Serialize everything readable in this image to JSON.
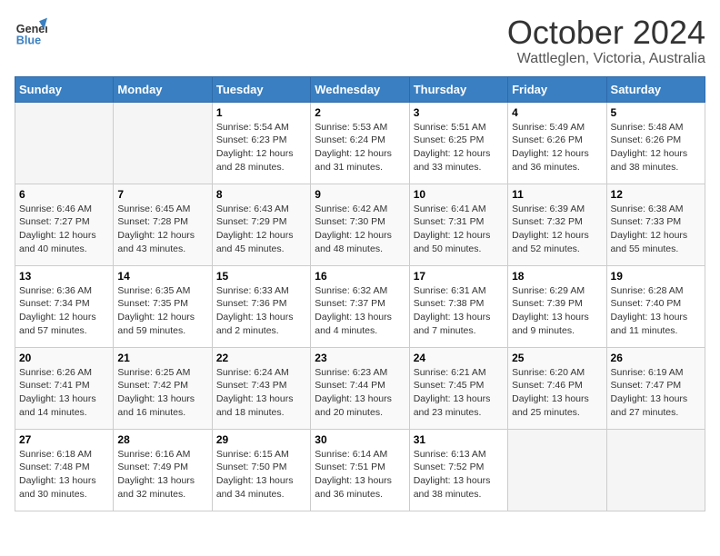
{
  "header": {
    "logo_line1": "General",
    "logo_line2": "Blue",
    "month": "October 2024",
    "location": "Wattleglen, Victoria, Australia"
  },
  "days_of_week": [
    "Sunday",
    "Monday",
    "Tuesday",
    "Wednesday",
    "Thursday",
    "Friday",
    "Saturday"
  ],
  "weeks": [
    [
      {
        "day": "",
        "info": ""
      },
      {
        "day": "",
        "info": ""
      },
      {
        "day": "1",
        "info": "Sunrise: 5:54 AM\nSunset: 6:23 PM\nDaylight: 12 hours and 28 minutes."
      },
      {
        "day": "2",
        "info": "Sunrise: 5:53 AM\nSunset: 6:24 PM\nDaylight: 12 hours and 31 minutes."
      },
      {
        "day": "3",
        "info": "Sunrise: 5:51 AM\nSunset: 6:25 PM\nDaylight: 12 hours and 33 minutes."
      },
      {
        "day": "4",
        "info": "Sunrise: 5:49 AM\nSunset: 6:26 PM\nDaylight: 12 hours and 36 minutes."
      },
      {
        "day": "5",
        "info": "Sunrise: 5:48 AM\nSunset: 6:26 PM\nDaylight: 12 hours and 38 minutes."
      }
    ],
    [
      {
        "day": "6",
        "info": "Sunrise: 6:46 AM\nSunset: 7:27 PM\nDaylight: 12 hours and 40 minutes."
      },
      {
        "day": "7",
        "info": "Sunrise: 6:45 AM\nSunset: 7:28 PM\nDaylight: 12 hours and 43 minutes."
      },
      {
        "day": "8",
        "info": "Sunrise: 6:43 AM\nSunset: 7:29 PM\nDaylight: 12 hours and 45 minutes."
      },
      {
        "day": "9",
        "info": "Sunrise: 6:42 AM\nSunset: 7:30 PM\nDaylight: 12 hours and 48 minutes."
      },
      {
        "day": "10",
        "info": "Sunrise: 6:41 AM\nSunset: 7:31 PM\nDaylight: 12 hours and 50 minutes."
      },
      {
        "day": "11",
        "info": "Sunrise: 6:39 AM\nSunset: 7:32 PM\nDaylight: 12 hours and 52 minutes."
      },
      {
        "day": "12",
        "info": "Sunrise: 6:38 AM\nSunset: 7:33 PM\nDaylight: 12 hours and 55 minutes."
      }
    ],
    [
      {
        "day": "13",
        "info": "Sunrise: 6:36 AM\nSunset: 7:34 PM\nDaylight: 12 hours and 57 minutes."
      },
      {
        "day": "14",
        "info": "Sunrise: 6:35 AM\nSunset: 7:35 PM\nDaylight: 12 hours and 59 minutes."
      },
      {
        "day": "15",
        "info": "Sunrise: 6:33 AM\nSunset: 7:36 PM\nDaylight: 13 hours and 2 minutes."
      },
      {
        "day": "16",
        "info": "Sunrise: 6:32 AM\nSunset: 7:37 PM\nDaylight: 13 hours and 4 minutes."
      },
      {
        "day": "17",
        "info": "Sunrise: 6:31 AM\nSunset: 7:38 PM\nDaylight: 13 hours and 7 minutes."
      },
      {
        "day": "18",
        "info": "Sunrise: 6:29 AM\nSunset: 7:39 PM\nDaylight: 13 hours and 9 minutes."
      },
      {
        "day": "19",
        "info": "Sunrise: 6:28 AM\nSunset: 7:40 PM\nDaylight: 13 hours and 11 minutes."
      }
    ],
    [
      {
        "day": "20",
        "info": "Sunrise: 6:26 AM\nSunset: 7:41 PM\nDaylight: 13 hours and 14 minutes."
      },
      {
        "day": "21",
        "info": "Sunrise: 6:25 AM\nSunset: 7:42 PM\nDaylight: 13 hours and 16 minutes."
      },
      {
        "day": "22",
        "info": "Sunrise: 6:24 AM\nSunset: 7:43 PM\nDaylight: 13 hours and 18 minutes."
      },
      {
        "day": "23",
        "info": "Sunrise: 6:23 AM\nSunset: 7:44 PM\nDaylight: 13 hours and 20 minutes."
      },
      {
        "day": "24",
        "info": "Sunrise: 6:21 AM\nSunset: 7:45 PM\nDaylight: 13 hours and 23 minutes."
      },
      {
        "day": "25",
        "info": "Sunrise: 6:20 AM\nSunset: 7:46 PM\nDaylight: 13 hours and 25 minutes."
      },
      {
        "day": "26",
        "info": "Sunrise: 6:19 AM\nSunset: 7:47 PM\nDaylight: 13 hours and 27 minutes."
      }
    ],
    [
      {
        "day": "27",
        "info": "Sunrise: 6:18 AM\nSunset: 7:48 PM\nDaylight: 13 hours and 30 minutes."
      },
      {
        "day": "28",
        "info": "Sunrise: 6:16 AM\nSunset: 7:49 PM\nDaylight: 13 hours and 32 minutes."
      },
      {
        "day": "29",
        "info": "Sunrise: 6:15 AM\nSunset: 7:50 PM\nDaylight: 13 hours and 34 minutes."
      },
      {
        "day": "30",
        "info": "Sunrise: 6:14 AM\nSunset: 7:51 PM\nDaylight: 13 hours and 36 minutes."
      },
      {
        "day": "31",
        "info": "Sunrise: 6:13 AM\nSunset: 7:52 PM\nDaylight: 13 hours and 38 minutes."
      },
      {
        "day": "",
        "info": ""
      },
      {
        "day": "",
        "info": ""
      }
    ]
  ]
}
